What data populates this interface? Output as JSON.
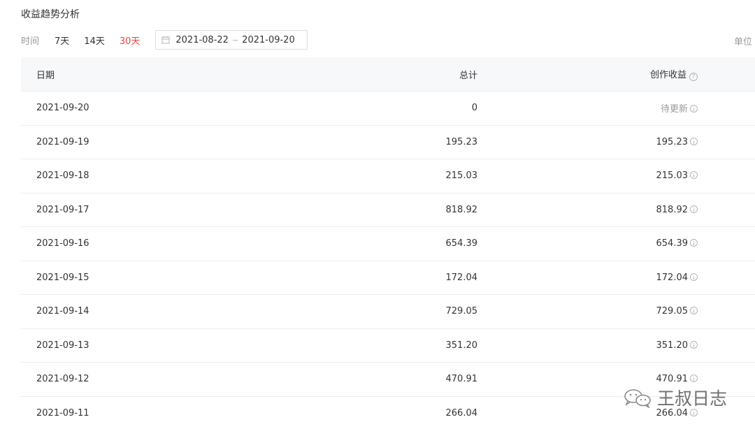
{
  "page": {
    "title": "收益趋势分析"
  },
  "filters": {
    "time_label": "时间",
    "ranges": [
      {
        "label": "7天",
        "active": false
      },
      {
        "label": "14天",
        "active": false
      },
      {
        "label": "30天",
        "active": true
      }
    ],
    "date_start": "2021-08-22",
    "date_separator": "~",
    "date_end": "2021-09-20",
    "unit_label": "单位"
  },
  "table": {
    "headers": {
      "date": "日期",
      "total": "总计",
      "income": "创作收益"
    },
    "rows": [
      {
        "date": "2021-09-20",
        "total": "0",
        "income": "待更新"
      },
      {
        "date": "2021-09-19",
        "total": "195.23",
        "income": "195.23"
      },
      {
        "date": "2021-09-18",
        "total": "215.03",
        "income": "215.03"
      },
      {
        "date": "2021-09-17",
        "total": "818.92",
        "income": "818.92"
      },
      {
        "date": "2021-09-16",
        "total": "654.39",
        "income": "654.39"
      },
      {
        "date": "2021-09-15",
        "total": "172.04",
        "income": "172.04"
      },
      {
        "date": "2021-09-14",
        "total": "729.05",
        "income": "729.05"
      },
      {
        "date": "2021-09-13",
        "total": "351.20",
        "income": "351.20"
      },
      {
        "date": "2021-09-12",
        "total": "470.91",
        "income": "470.91"
      },
      {
        "date": "2021-09-11",
        "total": "266.04",
        "income": "266.04"
      }
    ]
  },
  "watermark": {
    "text": "王叔日志",
    "icon": "wechat-icon"
  },
  "colors": {
    "accent_active": "#f04142",
    "header_bg": "#f7f8fa",
    "muted_text": "#999999"
  }
}
